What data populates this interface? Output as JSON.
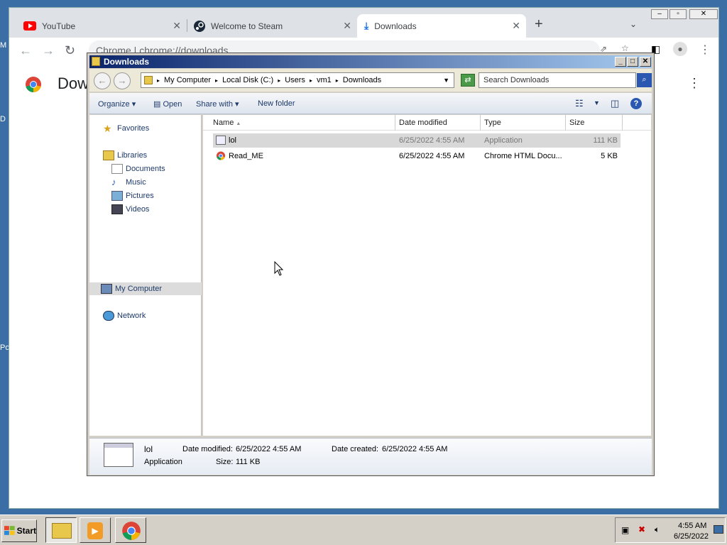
{
  "desktop": {
    "label_m": "M",
    "label_d": "D",
    "label_p": "Po"
  },
  "chrome": {
    "tabs": [
      {
        "title": "YouTube"
      },
      {
        "title": "Welcome to Steam"
      },
      {
        "title": "Downloads"
      }
    ],
    "new_tab": "+",
    "tab_close": "✕",
    "omnibox_text": "Chrome  |  chrome://downloads",
    "page_title": "Dow"
  },
  "explorer": {
    "title": "Downloads",
    "breadcrumbs": [
      "My Computer",
      "Local Disk (C:)",
      "Users",
      "vm1",
      "Downloads"
    ],
    "search_placeholder": "Search Downloads",
    "commands": {
      "organize": "Organize",
      "open": "Open",
      "share": "Share with",
      "newfolder": "New folder"
    },
    "nav": {
      "favorites": "Favorites",
      "libraries": "Libraries",
      "documents": "Documents",
      "music": "Music",
      "pictures": "Pictures",
      "videos": "Videos",
      "mycomputer": "My Computer",
      "network": "Network"
    },
    "columns": {
      "name": "Name",
      "date": "Date modified",
      "type": "Type",
      "size": "Size"
    },
    "files": [
      {
        "name": "lol",
        "date": "6/25/2022 4:55 AM",
        "type": "Application",
        "size": "111 KB"
      },
      {
        "name": "Read_ME",
        "date": "6/25/2022 4:55 AM",
        "type": "Chrome HTML Docu...",
        "size": "5 KB"
      }
    ],
    "details": {
      "name": "lol",
      "kind": "Application",
      "modified_label": "Date modified:",
      "modified": "6/25/2022 4:55 AM",
      "created_label": "Date created:",
      "created": "6/25/2022 4:55 AM",
      "size_label": "Size:",
      "size": "111 KB"
    }
  },
  "taskbar": {
    "start": "Start",
    "time": "4:55 AM",
    "date": "6/25/2022"
  }
}
